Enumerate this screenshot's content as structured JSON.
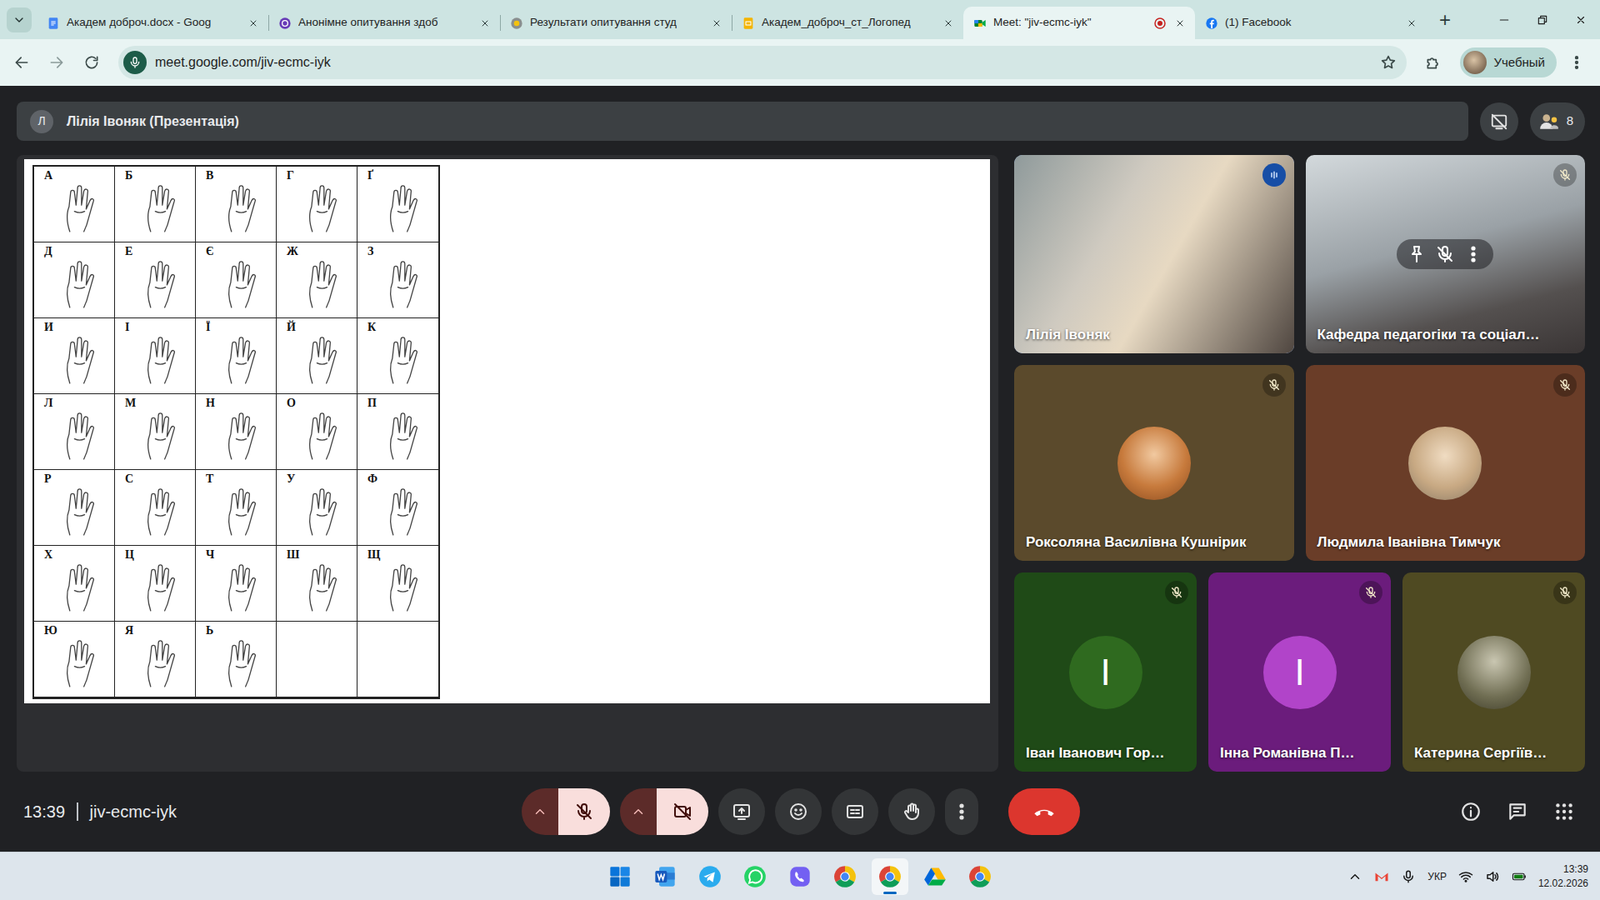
{
  "browser": {
    "tabs": [
      {
        "label": "Академ доброч.docx - Goog",
        "kind": "docs",
        "selected": false,
        "recording": false
      },
      {
        "label": "Анонімне опитування здоб",
        "kind": "forms",
        "selected": false,
        "recording": false
      },
      {
        "label": "Результати опитування студ",
        "kind": "survey",
        "selected": false,
        "recording": false
      },
      {
        "label": "Академ_доброч_ст_Логопед",
        "kind": "slides",
        "selected": false,
        "recording": false
      },
      {
        "label": "Meet: \"jiv-ecmc-iyk\"",
        "kind": "meet",
        "selected": true,
        "recording": true
      },
      {
        "label": "(1) Facebook",
        "kind": "facebook",
        "selected": false,
        "recording": false
      }
    ],
    "new_tab": "+",
    "url": "meet.google.com/jiv-ecmc-iyk",
    "bookmarked": false,
    "profile": "Учебный"
  },
  "meet": {
    "presenter_initial": "Л",
    "presenter": "Лілія Івоняк (Презентація)",
    "participants_count": "8",
    "slide": {
      "rows": [
        [
          "А",
          "Б",
          "В",
          "Г",
          "Ґ"
        ],
        [
          "Д",
          "Е",
          "Є",
          "Ж",
          "З"
        ],
        [
          "И",
          "І",
          "Ї",
          "Й",
          "К"
        ],
        [
          "Л",
          "М",
          "Н",
          "О",
          "П"
        ],
        [
          "Р",
          "С",
          "Т",
          "У",
          "Ф"
        ],
        [
          "Х",
          "Ц",
          "Ч",
          "Ш",
          "Щ"
        ],
        [
          "Ю",
          "Я",
          "Ь"
        ]
      ]
    },
    "tiles": [
      {
        "name": "Лілія Івоняк",
        "kind": "video",
        "muted": false,
        "speaking": true,
        "hovered": false
      },
      {
        "name": "Кафедра педагогіки та соціал…",
        "kind": "video",
        "muted": true,
        "speaking": false,
        "hovered": true
      },
      {
        "name": "Роксоляна Василівна Кушнірик",
        "kind": "photo-avatar",
        "muted": true,
        "speaking": false,
        "hovered": false,
        "color": "#5b4a2c"
      },
      {
        "name": "Людмила Іванівна Тимчук",
        "kind": "photo-avatar",
        "muted": true,
        "speaking": false,
        "hovered": false,
        "color": "#6a3d28"
      },
      {
        "name": "Іван Іванович Гор…",
        "kind": "letter-avatar",
        "muted": true,
        "speaking": false,
        "hovered": false,
        "color": "#1f4a17",
        "avatar_letter": "І",
        "avatar_color": "#2f6a1f"
      },
      {
        "name": "Інна Романівна П…",
        "kind": "letter-avatar",
        "muted": true,
        "speaking": false,
        "hovered": false,
        "color": "#6b1c7c",
        "avatar_letter": "І",
        "avatar_color": "#b144c9"
      },
      {
        "name": "Катерина Сергіїв…",
        "kind": "photo-avatar",
        "muted": true,
        "speaking": false,
        "hovered": false,
        "color": "#4f4a22"
      }
    ],
    "time": "13:39",
    "code": "jiv-ecmc-iyk",
    "mic_on": false,
    "camera_on": false
  },
  "taskbar": {
    "apps": [
      {
        "kind": "start",
        "selected": false
      },
      {
        "kind": "word",
        "selected": false
      },
      {
        "kind": "telegram",
        "selected": false
      },
      {
        "kind": "whatsapp",
        "selected": false
      },
      {
        "kind": "viber",
        "selected": false
      },
      {
        "kind": "chrome",
        "selected": false
      },
      {
        "kind": "chrome",
        "selected": true
      },
      {
        "kind": "drive",
        "selected": false
      },
      {
        "kind": "chrome",
        "selected": false
      }
    ],
    "language": "УКР",
    "time": "13:39",
    "date": "12.02.2026"
  }
}
